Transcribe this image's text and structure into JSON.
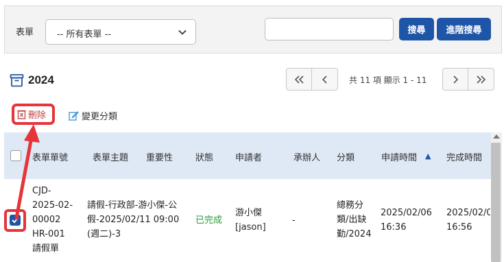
{
  "filter": {
    "label": "表單",
    "select_value": "-- 所有表單 --",
    "search_placeholder": "",
    "search_button": "搜尋",
    "advanced_button": "進階搜尋"
  },
  "folder": {
    "title": "2024"
  },
  "pagination": {
    "info": "共 11 項 顯示 1 - 11"
  },
  "actions": {
    "delete": "刪除",
    "change_category": "變更分類"
  },
  "table": {
    "headers": [
      "表單單號",
      "表單主題",
      "重要性",
      "狀態",
      "申請者",
      "承辦人",
      "分類",
      "申請時間",
      "完成時間"
    ],
    "sort_indicator": "▲",
    "row": {
      "id_line1": "CJD-",
      "id_line2": "2025-02-",
      "id_line3": "00002",
      "form_code": "HR-001",
      "form_name": "請假單",
      "subject_line1": "請假-行政部-游小傑-公",
      "subject_line2": "假-2025/02/11 09:00",
      "subject_line3": "(週二)-3",
      "status": "已完成",
      "applicant_line1": "游小傑",
      "applicant_line2": "[jason]",
      "handler": "-",
      "category_line1": "總務分",
      "category_line2": "類/出缺",
      "category_line3": "勤/2024",
      "apply_date": "2025/02/06",
      "apply_time": "16:36",
      "done_date": "2025/02/0",
      "done_time": "16:56"
    }
  },
  "colors": {
    "primary": "#1f55a6",
    "annotation_red": "#e5343a",
    "done_green": "#2a9a3c",
    "header_bg": "#dfe8f5"
  }
}
